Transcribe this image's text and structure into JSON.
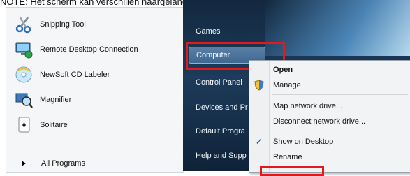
{
  "note": "NOTE: Het scherm kan verschillen naargelang het besturingssysteem dat u gebrui",
  "left_items": [
    {
      "label": "Snipping Tool"
    },
    {
      "label": "Remote Desktop Connection"
    },
    {
      "label": "NewSoft CD Labeler"
    },
    {
      "label": "Magnifier"
    },
    {
      "label": "Solitaire"
    }
  ],
  "all_programs": "All Programs",
  "right_items": [
    {
      "label": "Games"
    },
    {
      "label": "Computer"
    },
    {
      "label": "Control Panel"
    },
    {
      "label": "Devices and Pr"
    },
    {
      "label": "Default Progra"
    },
    {
      "label": "Help and Supp"
    }
  ],
  "context_menu": {
    "items": [
      {
        "label": "Open"
      },
      {
        "label": "Manage"
      },
      {
        "label": "Map network drive..."
      },
      {
        "label": "Disconnect network drive..."
      },
      {
        "label": "Show on Desktop"
      },
      {
        "label": "Rename"
      }
    ]
  },
  "colors": {
    "highlight_border": "#e11b1b",
    "right_pane": "#1d3b5a"
  }
}
